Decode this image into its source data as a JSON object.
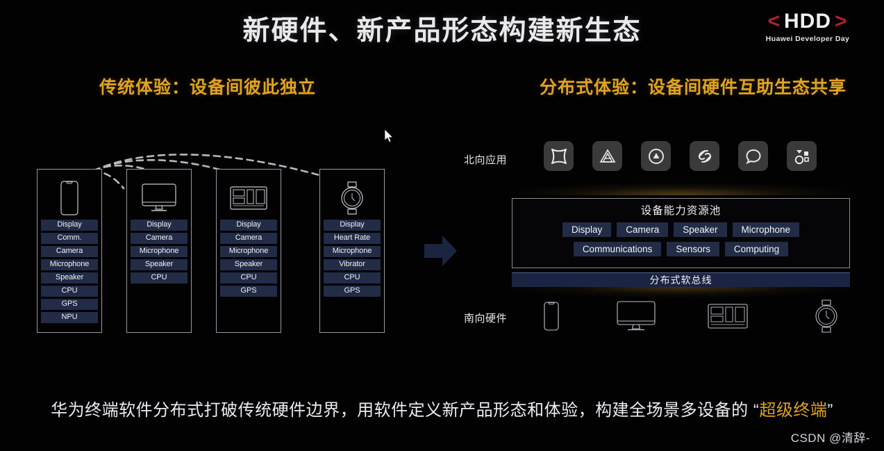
{
  "slide": {
    "title": "新硬件、新产品形态构建新生态",
    "caption_part1": "华为终端软件分布式打破传统硬件边界，用软件定义新产品形态和体验，构建全场景多设备的 “",
    "caption_highlight": "超级终端",
    "caption_part2": "”",
    "watermark": "CSDN @清辞-",
    "accent_gold": "#e0a323",
    "chip_navy": "#222c46",
    "bus_navy": "#1b2442",
    "logo_red": "#b3202c"
  },
  "logo": {
    "bracket_left": "<",
    "text": "HDD",
    "bracket_right": ">",
    "subtitle": "Huawei Developer Day"
  },
  "left": {
    "heading": "传统体验：设备间彼此独立",
    "devices": [
      {
        "glyph": "phone-outline-icon",
        "capabilities": [
          "Display",
          "Comm.",
          "Camera",
          "Microphone",
          "Speaker",
          "CPU",
          "GPS",
          "NPU"
        ]
      },
      {
        "glyph": "monitor-outline-icon",
        "capabilities": [
          "Display",
          "Camera",
          "Microphone",
          "Speaker",
          "CPU"
        ]
      },
      {
        "glyph": "car-dashboard-outline-icon",
        "capabilities": [
          "Display",
          "Camera",
          "Microphone",
          "Speaker",
          "CPU",
          "GPS"
        ]
      },
      {
        "glyph": "watch-outline-icon",
        "capabilities": [
          "Display",
          "Heart Rate",
          "Microphone",
          "Vibrator",
          "CPU",
          "GPS"
        ]
      }
    ]
  },
  "right": {
    "heading": "分布式体验：设备间硬件互助生态共享",
    "northbound_label": "北向应用",
    "app_icons": [
      "concave-square-app-icon",
      "triangle-knot-app-icon",
      "circle-triangle-app-icon",
      "s-knot-app-icon",
      "speech-bubble-app-icon",
      "shapes-app-icon"
    ],
    "pool_title": "设备能力资源池",
    "pool_row1": [
      "Display",
      "Camera",
      "Speaker",
      "Microphone"
    ],
    "pool_row2": [
      "Communications",
      "Sensors",
      "Computing"
    ],
    "softbus_label": "分布式软总线",
    "southbound_label": "南向硬件",
    "hardware_icons": [
      "phone-outline-icon",
      "monitor-outline-icon",
      "car-dashboard-outline-icon",
      "watch-outline-icon"
    ]
  }
}
